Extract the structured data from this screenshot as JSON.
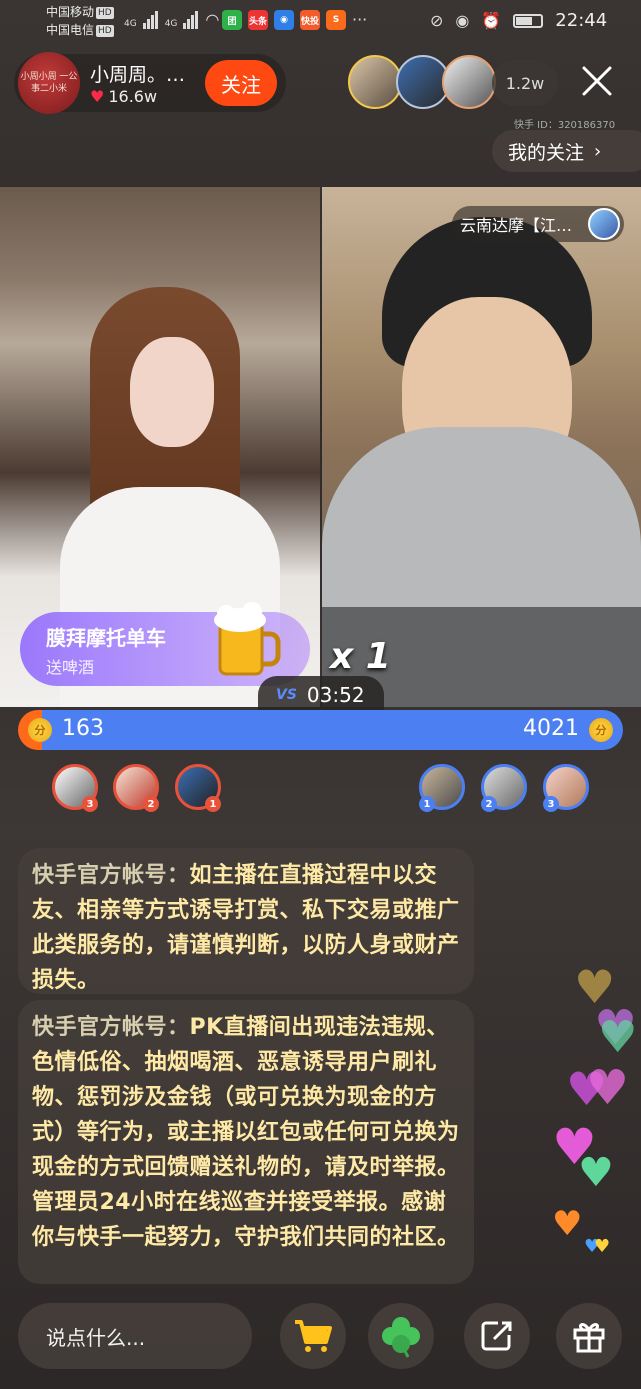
{
  "status_bar": {
    "carrier_1": "中国移动",
    "carrier_2": "中国电信",
    "hd": "HD",
    "signal_label": "4G",
    "time": "22:44",
    "app_icons": [
      "团",
      "头条",
      "",
      "快投",
      ""
    ]
  },
  "host": {
    "name": "小周周。…",
    "likes": "16.6w",
    "follow_label": "关注",
    "avatar_text": "小周小周 一公事二小米"
  },
  "viewers": {
    "count": "1.2w",
    "kuaishou_id": "快手 ID：320186370"
  },
  "my_follow": {
    "label": "我的关注"
  },
  "opponent": {
    "name": "云南达摩【江…"
  },
  "gift_banner": {
    "title": "膜拜摩托单车",
    "subtitle": "送啤酒",
    "multiplier": "x 1"
  },
  "pk": {
    "vs_label": "VS",
    "timer": "03:52",
    "left_score": "163",
    "right_score": "4021",
    "left_progress": 0.04,
    "coin_char": "分"
  },
  "left_ranks": [
    "3",
    "2",
    "1"
  ],
  "right_ranks": [
    "1",
    "2",
    "3"
  ],
  "messages": [
    {
      "sender": "快手官方帐号：",
      "text": "如主播在直播过程中以交友、相亲等方式诱导打赏、私下交易或推广此类服务的，请谨慎判断，以防人身或财产损失。"
    },
    {
      "sender": "快手官方帐号：",
      "text": "PK直播间出现违法违规、色情低俗、抽烟喝酒、恶意诱导用户刷礼物、惩罚涉及金钱（或可兑换为现金的方式）等行为，或主播以红包或任何可兑换为现金的方式回馈赠送礼物的，请及时举报。管理员24小时在线巡查并接受举报。感谢你与快手一起努力，守护我们共同的社区。"
    }
  ],
  "bottom": {
    "input_placeholder": "说点什么..."
  },
  "colors": {
    "follow": "#fe4a12",
    "pk_left": "#ff6a1a",
    "pk_right": "#4b7ff2",
    "message_text": "#ffe9a6"
  }
}
